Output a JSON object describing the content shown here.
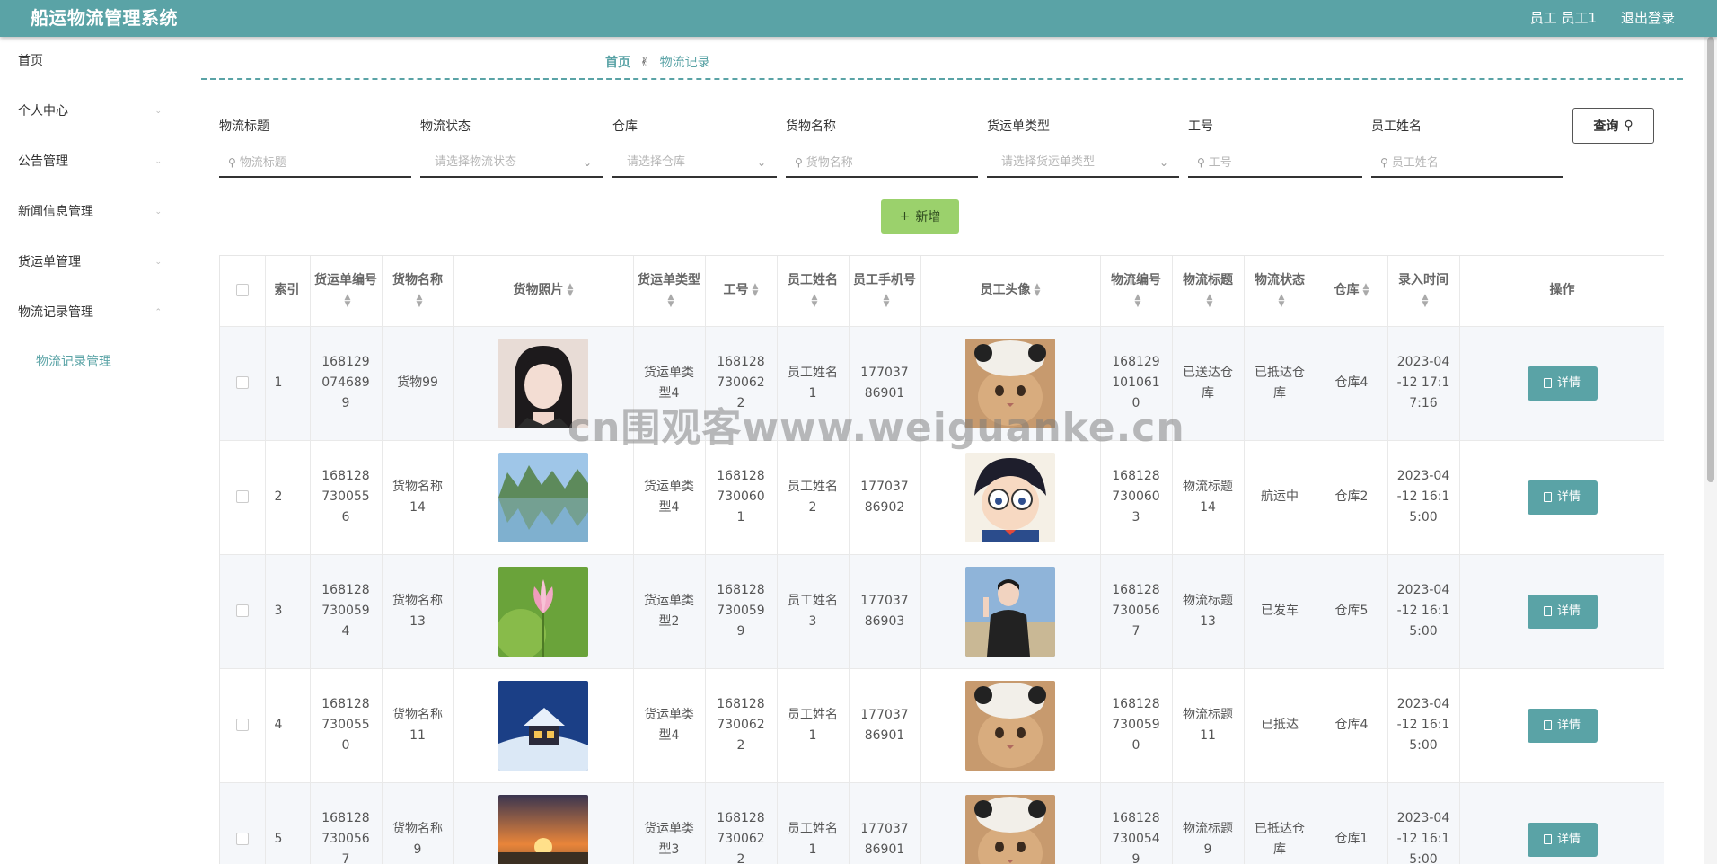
{
  "header": {
    "title": "船运物流管理系统",
    "user": "员工 员工1",
    "logout": "退出登录"
  },
  "sidebar": {
    "items": [
      {
        "label": "首页"
      },
      {
        "label": "个人中心"
      },
      {
        "label": "公告管理"
      },
      {
        "label": "新闻信息管理"
      },
      {
        "label": "货运单管理"
      },
      {
        "label": "物流记录管理"
      }
    ],
    "sub_item": "物流记录管理"
  },
  "breadcrumb": {
    "home": "首页",
    "current": "物流记录"
  },
  "filters": [
    {
      "label": "物流标题",
      "placeholder": "物流标题",
      "type": "input"
    },
    {
      "label": "物流状态",
      "placeholder": "请选择物流状态",
      "type": "select"
    },
    {
      "label": "仓库",
      "placeholder": "请选择仓库",
      "type": "select"
    },
    {
      "label": "货物名称",
      "placeholder": "货物名称",
      "type": "input"
    },
    {
      "label": "货运单类型",
      "placeholder": "请选择货运单类型",
      "type": "select"
    },
    {
      "label": "工号",
      "placeholder": "工号",
      "type": "input"
    },
    {
      "label": "员工姓名",
      "placeholder": "员工姓名",
      "type": "input"
    }
  ],
  "buttons": {
    "query": "查询",
    "add": "新增",
    "detail": "详情"
  },
  "table": {
    "headers": [
      "索引",
      "货运单编号",
      "货物名称",
      "货物照片",
      "货运单类型",
      "工号",
      "员工姓名",
      "员工手机号",
      "员工头像",
      "物流编号",
      "物流标题",
      "物流状态",
      "仓库",
      "录入时间",
      "操作"
    ],
    "rows": [
      {
        "index": "1",
        "order_no": "1681290746899",
        "goods": "货物99",
        "goods_img": "portrait",
        "type": "货运单类型4",
        "emp_no": "1681287300622",
        "emp_name": "员工姓名1",
        "phone": "17703786901",
        "avatar": "cat",
        "log_no": "1681291010610",
        "log_title": "已送达仓库",
        "status": "已抵达仓库",
        "warehouse": "仓库4",
        "time": "2023-04-12 17:17:16"
      },
      {
        "index": "2",
        "order_no": "1681287300556",
        "goods": "货物名称14",
        "goods_img": "lake",
        "type": "货运单类型4",
        "emp_no": "1681287300601",
        "emp_name": "员工姓名2",
        "phone": "17703786902",
        "avatar": "cartoon",
        "log_no": "1681287300603",
        "log_title": "物流标题14",
        "status": "航运中",
        "warehouse": "仓库2",
        "time": "2023-04-12 16:15:00"
      },
      {
        "index": "3",
        "order_no": "1681287300594",
        "goods": "货物名称13",
        "goods_img": "lotus",
        "type": "货运单类型2",
        "emp_no": "1681287300599",
        "emp_name": "员工姓名3",
        "phone": "17703786903",
        "avatar": "person",
        "log_no": "1681287300567",
        "log_title": "物流标题13",
        "status": "已发车",
        "warehouse": "仓库5",
        "time": "2023-04-12 16:15:00"
      },
      {
        "index": "4",
        "order_no": "1681287300550",
        "goods": "货物名称11",
        "goods_img": "snow",
        "type": "货运单类型4",
        "emp_no": "1681287300622",
        "emp_name": "员工姓名1",
        "phone": "17703786901",
        "avatar": "cat",
        "log_no": "1681287300590",
        "log_title": "物流标题11",
        "status": "已抵达",
        "warehouse": "仓库4",
        "time": "2023-04-12 16:15:00"
      },
      {
        "index": "5",
        "order_no": "1681287300567",
        "goods": "货物名称9",
        "goods_img": "sunset",
        "type": "货运单类型3",
        "emp_no": "1681287300622",
        "emp_name": "员工姓名1",
        "phone": "17703786901",
        "avatar": "cat",
        "log_no": "1681287300549",
        "log_title": "物流标题9",
        "status": "已抵达仓库",
        "warehouse": "仓库1",
        "time": "2023-04-12 16:15:00"
      }
    ]
  },
  "watermark": "cn围观客www.weiguanke.cn",
  "colors": {
    "primary": "#5aa3a6",
    "add": "#9bd16c"
  },
  "icons": {
    "search": "search-icon",
    "plus": "plus-icon",
    "doc": "document-icon",
    "chevron": "chevron-down-icon",
    "sort": "sort-icon"
  }
}
